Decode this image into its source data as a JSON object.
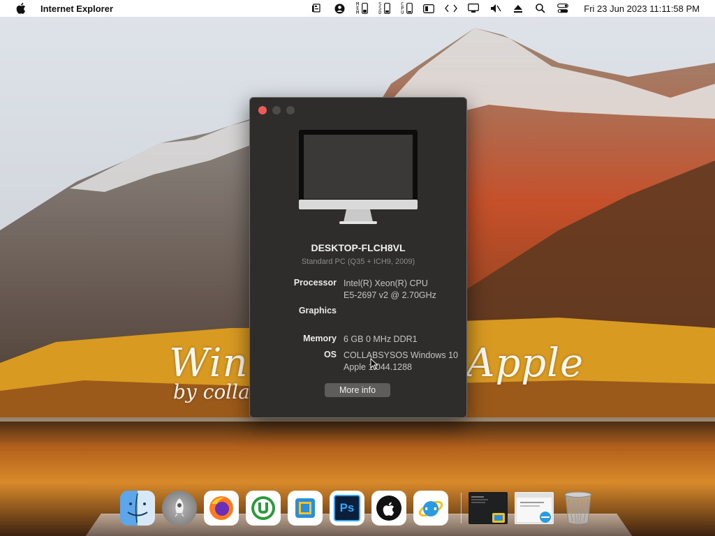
{
  "menubar": {
    "app_name": "Internet Explorer",
    "clock": "Fri 23 Jun 2023  11:11:58 PM",
    "status_items": [
      "network-monitor-icon",
      "user-icon",
      "memory-monitor-icon",
      "ssd-monitor-icon",
      "cpu-monitor-icon",
      "window-switch-icon",
      "code-icon",
      "display-icon",
      "mute-icon",
      "eject-icon",
      "search-icon",
      "control-center-icon"
    ],
    "labels": {
      "mem": "MEM",
      "ssd": "SSD",
      "cpu": "CPU"
    }
  },
  "wallpaper": {
    "text_left": "Win",
    "text_right": "Apple",
    "text_sub": "by colla"
  },
  "about": {
    "computer_name": "DESKTOP-FLCH8VL",
    "model": "Standard PC (Q35 + ICH9, 2009)",
    "processor_label": "Processor",
    "processor_line1": "Intel(R) Xeon(R) CPU",
    "processor_line2": "E5-2697 v2 @ 2.70GHz",
    "graphics_label": "Graphics",
    "memory_label": "Memory",
    "memory_value": "6 GB  0 MHz DDR1",
    "os_label": "OS",
    "os_line1": "COLLABSYSOS Windows 10",
    "os_line2": "Apple 1.044.1288",
    "more_info_button": "More info"
  },
  "dock": {
    "apps": [
      "Finder",
      "Launchpad",
      "Firefox",
      "uTorrent",
      "Files",
      "Photoshop",
      "Apple",
      "Internet Explorer"
    ],
    "photoshop_label": "Ps",
    "minimized": [
      "Desktop window thumbnail",
      "Internet Explorer window thumbnail"
    ],
    "trash": "Trash"
  },
  "colors": {
    "window_bg": "#2f2d2c",
    "close_button": "#ec5b55",
    "more_info_bg": "#5f5d5c"
  }
}
